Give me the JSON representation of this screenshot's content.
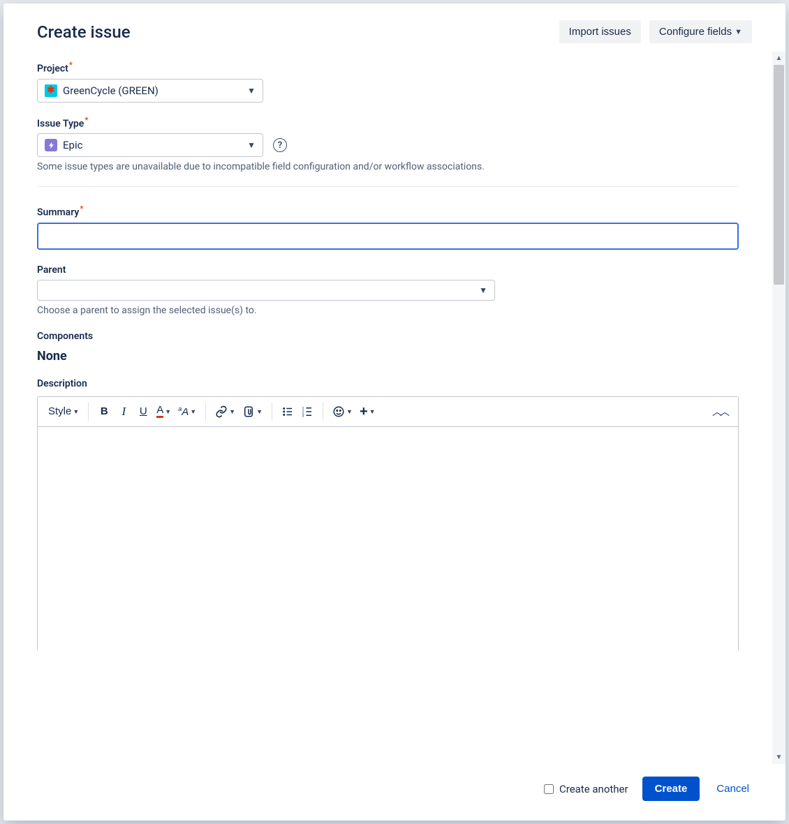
{
  "header": {
    "title": "Create issue",
    "import_label": "Import issues",
    "configure_label": "Configure fields"
  },
  "fields": {
    "project": {
      "label": "Project",
      "required": true,
      "value": "GreenCycle (GREEN)"
    },
    "issue_type": {
      "label": "Issue Type",
      "required": true,
      "value": "Epic",
      "hint": "Some issue types are unavailable due to incompatible field configuration and/or workflow associations."
    },
    "summary": {
      "label": "Summary",
      "required": true,
      "value": ""
    },
    "parent": {
      "label": "Parent",
      "value": "",
      "hint": "Choose a parent to assign the selected issue(s) to."
    },
    "components": {
      "label": "Components",
      "value": "None"
    },
    "description": {
      "label": "Description",
      "style_label": "Style"
    }
  },
  "footer": {
    "create_another_label": "Create another",
    "create_label": "Create",
    "cancel_label": "Cancel",
    "create_another_checked": false
  },
  "required_marker": "*"
}
